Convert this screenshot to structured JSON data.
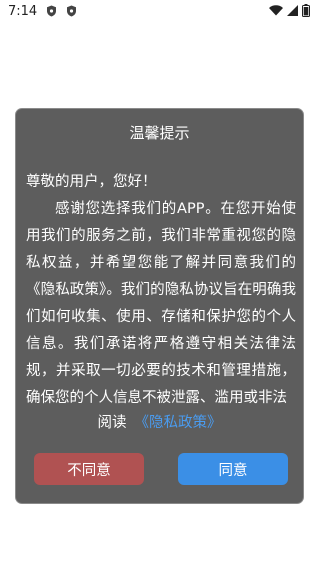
{
  "status_bar": {
    "time": "7:14",
    "notif_icons": [
      "shield-icon",
      "shield-icon"
    ],
    "right_icons": [
      "wifi-icon",
      "signal-icon",
      "battery-icon"
    ]
  },
  "dialog": {
    "title": "温馨提示",
    "greeting": "尊敬的用户，您好！",
    "body": "感谢您选择我们的APP。在您开始使用我们的服务之前，我们非常重视您的隐私权益，并希望您能了解并同意我们的《隐私政策》。我们的隐私协议旨在明确我们如何收集、使用、存储和保护您的个人信息。我们承诺将严格遵守相关法律法规，并采取一切必要的技术和管理措施，确保您的个人信息不被泄露、滥用或非法",
    "read_prefix": "阅读",
    "policy_link": "《隐私政策》",
    "disagree_label": "不同意",
    "agree_label": "同意"
  }
}
